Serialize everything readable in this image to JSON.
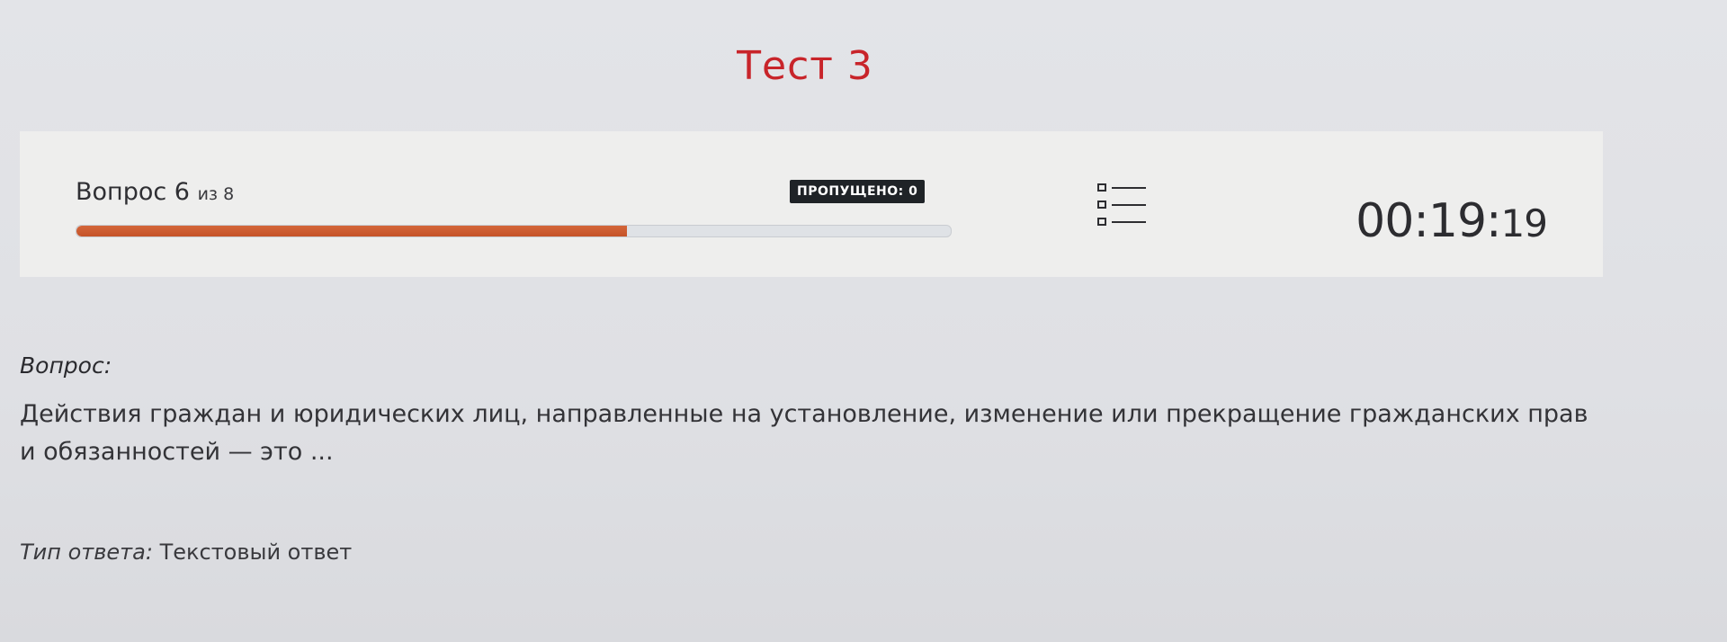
{
  "title": "Тест 3",
  "status": {
    "question_label": "Вопрос",
    "current_question": "6",
    "of_total": "из 8",
    "progress_fraction": 0.63,
    "skipped_badge": "ПРОПУЩЕНО: 0",
    "timer_main": "00:19:",
    "timer_seconds": "19",
    "list_icon": "question-list-icon"
  },
  "question": {
    "label": "Вопрос:",
    "text": "Действия граждан и юридических лиц, направленные на установление, изменение или прекращение гражданских прав и обязанностей — это ..."
  },
  "answer_type": {
    "label": "Тип ответа:",
    "value": "Текстовый ответ"
  },
  "colors": {
    "title": "#c8242a",
    "progress": "#c55328",
    "badge_bg": "#1f2327"
  }
}
